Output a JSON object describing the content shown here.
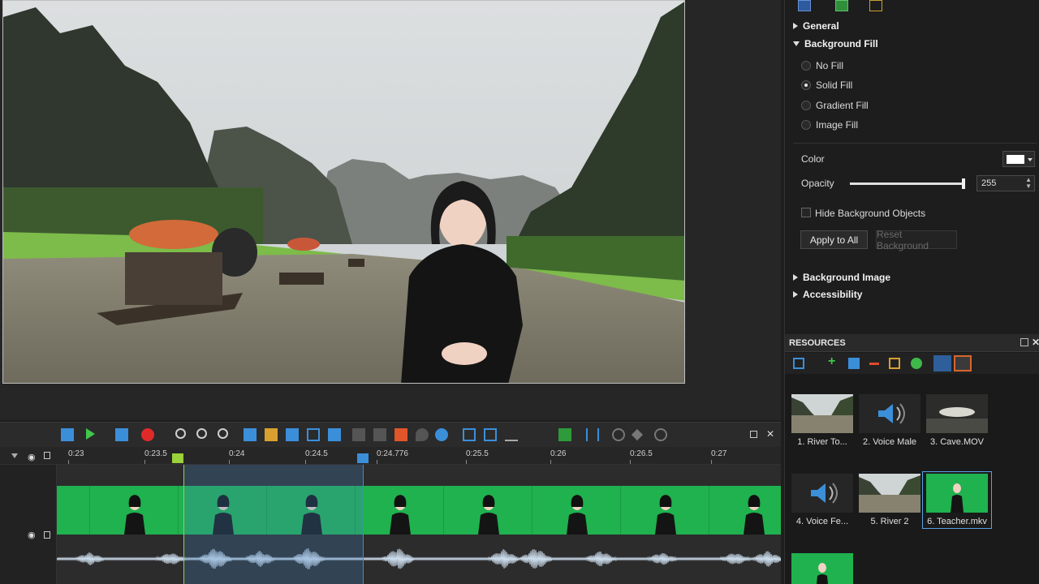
{
  "properties": {
    "sections": {
      "general": "General",
      "background_fill": "Background Fill",
      "background_image": "Background Image",
      "accessibility": "Accessibility"
    },
    "fill_options": [
      "No Fill",
      "Solid Fill",
      "Gradient Fill",
      "Image Fill"
    ],
    "selected_fill": "Solid Fill",
    "color_label": "Color",
    "color_value": "#ffffff",
    "opacity_label": "Opacity",
    "opacity_value": "255",
    "hide_bg_label": "Hide Background Objects",
    "apply_all_label": "Apply to All",
    "reset_bg_label": "Reset Background"
  },
  "resources": {
    "title": "RESOURCES",
    "items": [
      {
        "label": "1. River To...",
        "kind": "river"
      },
      {
        "label": "2. Voice Male",
        "kind": "audio"
      },
      {
        "label": "3. Cave.MOV",
        "kind": "cave"
      },
      {
        "label": "4. Voice Fe...",
        "kind": "audio"
      },
      {
        "label": "5. River 2",
        "kind": "river"
      },
      {
        "label": "6. Teacher.mkv",
        "kind": "teacher",
        "selected": true
      },
      {
        "label": "",
        "kind": "teacher"
      }
    ]
  },
  "timeline": {
    "ruler_labels": [
      "0:23",
      "0:23.5",
      "0:24",
      "0:24.5",
      "0:24.776",
      "0:25.5",
      "0:26",
      "0:26.5",
      "0:27"
    ]
  },
  "colors": {
    "green_screen": "#1fb24f",
    "accent_blue": "#3b8fd9",
    "playhead_green": "#9bd13a",
    "selection_blue": "#4682be"
  }
}
